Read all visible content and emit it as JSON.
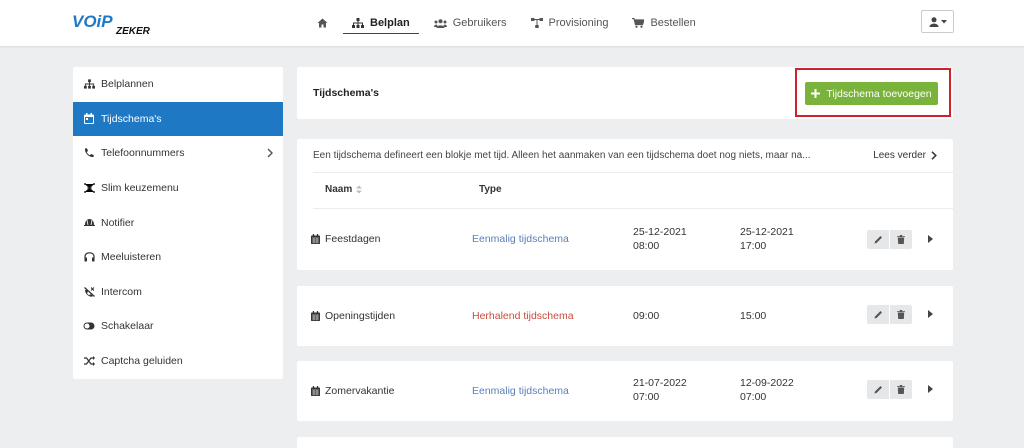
{
  "brand": {
    "logo_main": "VOiP",
    "logo_sub": "ZEKER",
    "color_primary": "#1f78c4",
    "color_secondary": "#111111"
  },
  "nav": {
    "items": [
      {
        "label": "",
        "icon": "home-icon"
      },
      {
        "label": "Belplan",
        "icon": "sitemap-icon",
        "active": true
      },
      {
        "label": "Gebruikers",
        "icon": "users-icon"
      },
      {
        "label": "Provisioning",
        "icon": "network-icon"
      },
      {
        "label": "Bestellen",
        "icon": "cart-icon"
      }
    ],
    "user_icon": "user-icon"
  },
  "sidebar": {
    "items": [
      {
        "label": "Belplannen",
        "icon": "sitemap-icon"
      },
      {
        "label": "Tijdschema's",
        "icon": "calendar-icon",
        "active": true
      },
      {
        "label": "Telefoonnummers",
        "icon": "phone-icon",
        "has_submenu": true
      },
      {
        "label": "Slim keuzemenu",
        "icon": "menu-tree-icon"
      },
      {
        "label": "Notifier",
        "icon": "bell-icon"
      },
      {
        "label": "Meeluisteren",
        "icon": "headphones-icon"
      },
      {
        "label": "Intercom",
        "icon": "intercom-icon"
      },
      {
        "label": "Schakelaar",
        "icon": "toggle-icon"
      },
      {
        "label": "Captcha geluiden",
        "icon": "shuffle-icon"
      }
    ]
  },
  "header": {
    "title": "Tijdschema's",
    "add_button": "Tijdschema toevoegen",
    "add_button_color": "#7ab33b",
    "highlight_color": "#d0202b"
  },
  "info": {
    "text": "Een tijdschema defineert een blokje met tijd. Alleen het aanmaken van een tijdschema doet nog niets, maar na...",
    "more_link": "Lees verder"
  },
  "table": {
    "columns": {
      "name": "Naam",
      "type": "Type"
    },
    "rows": [
      {
        "name": "Feestdagen",
        "type": "Eenmalig tijdschema",
        "type_kind": "once",
        "start_date": "25-12-2021",
        "start_time": "08:00",
        "end_date": "25-12-2021",
        "end_time": "17:00"
      },
      {
        "name": "Openingstijden",
        "type": "Herhalend tijdschema",
        "type_kind": "repeat",
        "start_date": "",
        "start_time": "09:00",
        "end_date": "",
        "end_time": "15:00"
      },
      {
        "name": "Zomervakantie",
        "type": "Eenmalig tijdschema",
        "type_kind": "once",
        "start_date": "21-07-2022",
        "start_time": "07:00",
        "end_date": "12-09-2022",
        "end_time": "07:00"
      }
    ]
  }
}
